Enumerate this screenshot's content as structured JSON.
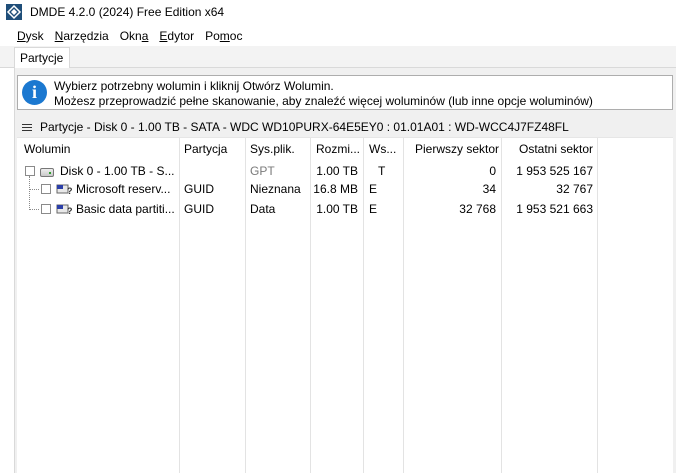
{
  "window": {
    "title": "DMDE 4.2.0 (2024) Free Edition x64",
    "app_icon": "dmde-diamond-icon"
  },
  "menu": [
    {
      "label": "Dysk",
      "mnemonic": "D",
      "rest": "ysk"
    },
    {
      "label": "Narzędzia",
      "mnemonic": "N",
      "rest": "arzędzia"
    },
    {
      "label": "Okna",
      "pre": "Okn",
      "mnemonic": "a",
      "rest": ""
    },
    {
      "label": "Edytor",
      "mnemonic": "E",
      "rest": "dytor"
    },
    {
      "label": "Pomoc",
      "pre": "Po",
      "mnemonic": "m",
      "rest": "oc"
    }
  ],
  "tabs": [
    {
      "label": "Partycje",
      "active": true
    }
  ],
  "info": {
    "icon": "info-icon",
    "line1": "Wybierz potrzebny wolumin i kliknij Otwórz Wolumin.",
    "line2": "Możesz przeprowadzić pełne skanowanie, aby znaleźć więcej woluminów (lub inne opcje woluminów)"
  },
  "panel": {
    "icon": "hamburger-icon",
    "title": "Partycje - Disk 0 - 1.00 TB - SATA - WDC WD10PURX-64E5EY0 : 01.01A01 : WD-WCC4J7FZ48FL"
  },
  "columns": [
    "Wolumin",
    "Partycja",
    "Sys.plik.",
    "Rozmi...",
    "Ws...",
    "Pierwszy sektor",
    "Ostatni sektor"
  ],
  "rows": [
    {
      "name": "Disk 0 - 1.00 TB - S...",
      "partition": "",
      "fs": "GPT",
      "size": "1.00 TB",
      "flags": "T",
      "first": "0",
      "last": "1 953 525 167",
      "icon": "hard-disk-icon"
    },
    {
      "name": "Microsoft reserv...",
      "partition": "GUID",
      "fs": "Nieznana",
      "size": "16.8 MB",
      "flags": "E",
      "first": "34",
      "last": "32 767",
      "icon": "volume-unknown-icon"
    },
    {
      "name": "Basic data partiti...",
      "partition": "GUID",
      "fs": "Data",
      "size": "1.00 TB",
      "flags": "E",
      "first": "32 768",
      "last": "1 953 521 663",
      "icon": "volume-unknown-icon"
    }
  ]
}
